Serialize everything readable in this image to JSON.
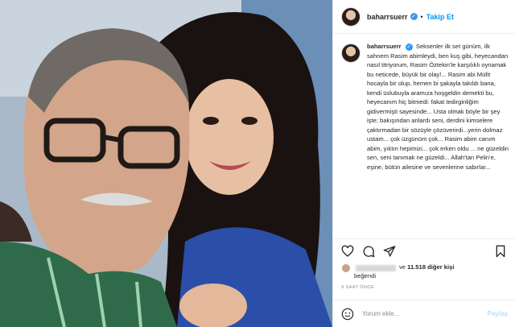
{
  "post": {
    "photo_alt": "Selfie of two people",
    "icon": "photo-image"
  },
  "header": {
    "username": "baharrsuerr",
    "verified_icon": "verified-badge-icon",
    "separator": "•",
    "follow_label": "Takip Et"
  },
  "caption": {
    "username": "baharrsuerr",
    "text": "Seksenler ilk set günüm, ilk sahnem Rasim abimleydi, ben kuş gibi, heyecandan nasıl titriyorum, Rasim Öztekin'le karşılıklı oynamak bu neticede, büyük bir olay!... Rasim abi Müfit hocayla bir olup, hemen bi şakayla takıldı bana, kendi üslubuyla aramıza hoşgeldin demekti bu, heyecanım hiç bitmedi: fakat tedirginliğim gidivermişti sayesinde... Usta olmak böyle bir şey işte; bakışından anlardı seni, derdini kimselere çaktırmadan bir sözüyle çözüverirdi...yerin dolmaz ustam... çok üzgünüm çok... Rasim abim canım abim, yıktın hepimizi... çok erken oldu ... ne güzeldin sen, seni tanımak ne güzeldi... Allah'tan Pelin'e, eşine, bütün ailesine ve sevenlerine sabırlar..."
  },
  "actions": {
    "like_icon": "heart-icon",
    "comment_icon": "comment-icon",
    "share_icon": "share-icon",
    "save_icon": "bookmark-icon"
  },
  "likes": {
    "and_text": "ve",
    "count": "11.518",
    "others_text": "diğer kişi",
    "liked_label": "beğendi"
  },
  "timestamp": "9 SAAT ÖNCE",
  "comment": {
    "emoji_icon": "smile-icon",
    "placeholder": "Yorum ekle...",
    "post_label": "Paylaş"
  },
  "colors": {
    "accent": "#0095f6",
    "post_disabled": "#b2dffc",
    "verified": "#3897f0",
    "muted": "#8e8e8e"
  }
}
